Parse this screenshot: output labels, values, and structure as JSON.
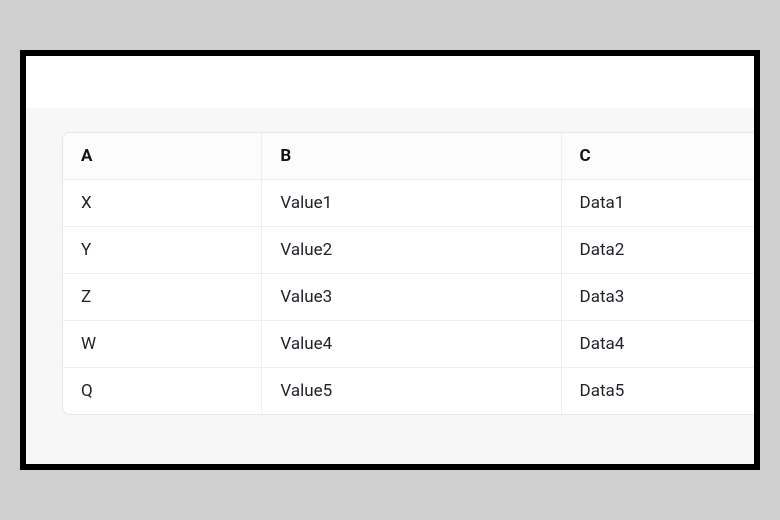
{
  "table": {
    "headers": [
      "A",
      "B",
      "C"
    ],
    "rows": [
      [
        "X",
        "Value1",
        "Data1"
      ],
      [
        "Y",
        "Value2",
        "Data2"
      ],
      [
        "Z",
        "Value3",
        "Data3"
      ],
      [
        "W",
        "Value4",
        "Data4"
      ],
      [
        "Q",
        "Value5",
        "Data5"
      ]
    ]
  }
}
